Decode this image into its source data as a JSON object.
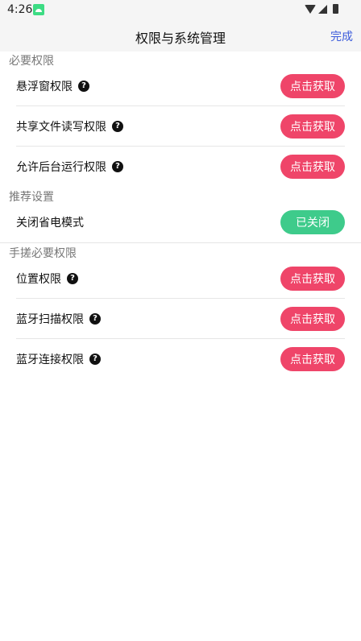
{
  "status": {
    "time": "4:26"
  },
  "header": {
    "title": "权限与系统管理",
    "done_label": "完成"
  },
  "sections": [
    {
      "title": "必要权限",
      "items": [
        {
          "label": "悬浮窗权限",
          "action": "点击获取"
        },
        {
          "label": "共享文件读写权限",
          "action": "点击获取"
        },
        {
          "label": "允许后台运行权限",
          "action": "点击获取"
        }
      ]
    },
    {
      "title": "推荐设置",
      "items": [
        {
          "label": "关闭省电模式",
          "action": "已关闭"
        }
      ]
    },
    {
      "title": "手搓必要权限",
      "items": [
        {
          "label": "位置权限",
          "action": "点击获取"
        },
        {
          "label": "蓝牙扫描权限",
          "action": "点击获取"
        },
        {
          "label": "蓝牙连接权限",
          "action": "点击获取"
        }
      ]
    }
  ],
  "colors": {
    "accent_red": "#ef4569",
    "accent_green": "#3ecb8b",
    "link_blue": "#3b5bdb"
  },
  "icons": {
    "help": "question-circle-icon"
  }
}
